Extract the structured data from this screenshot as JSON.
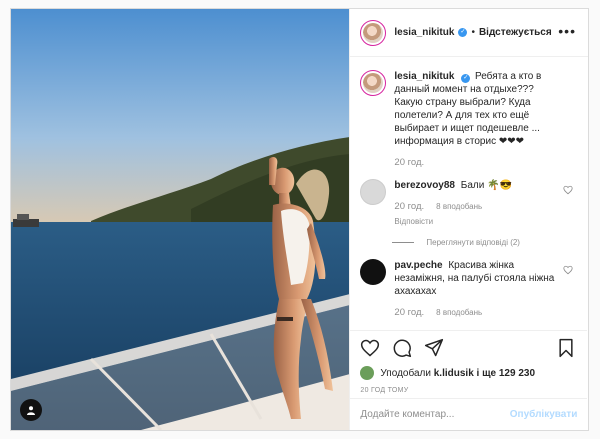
{
  "header": {
    "username": "lesia_nikituk",
    "separator": "•",
    "follow_label": "Відстежується",
    "more": "•••"
  },
  "caption": {
    "username": "lesia_nikituk",
    "text": "Ребята а кто в данный момент на отдыхе??? Какую страну выбрали? Куда полетели? А для тех кто ещё выбирает и ищет подешевле ... информация в сторис ❤❤❤",
    "time": "20 год."
  },
  "comments": [
    {
      "username": "berezovoy88",
      "text": "Бали 🌴😎",
      "time": "20 год.",
      "likes": "8 вподобань",
      "reply": "Відповісти",
      "view_replies": "Переглянути відповіді (2)"
    },
    {
      "username": "pav.peche",
      "text": "Красива жінка незаміжня, на палубі стояла ніжна ахахахах",
      "time": "20 год.",
      "likes": "8 вподобань"
    }
  ],
  "likes_text": {
    "prefix": "Уподобали",
    "user": "k.lidusik",
    "rest": "і ще 129 230"
  },
  "date": "20 ГОД ТОМУ",
  "comment_input": {
    "placeholder": "Додайте коментар...",
    "post_label": "Опублікувати"
  },
  "colors": {
    "verified": "#3897f0",
    "post_disabled": "#b3dbff",
    "muted": "#8e8e8e"
  },
  "icons": [
    "heart-icon",
    "comment-icon",
    "share-icon",
    "bookmark-icon",
    "user-tag-icon",
    "more-icon",
    "verified-icon"
  ]
}
